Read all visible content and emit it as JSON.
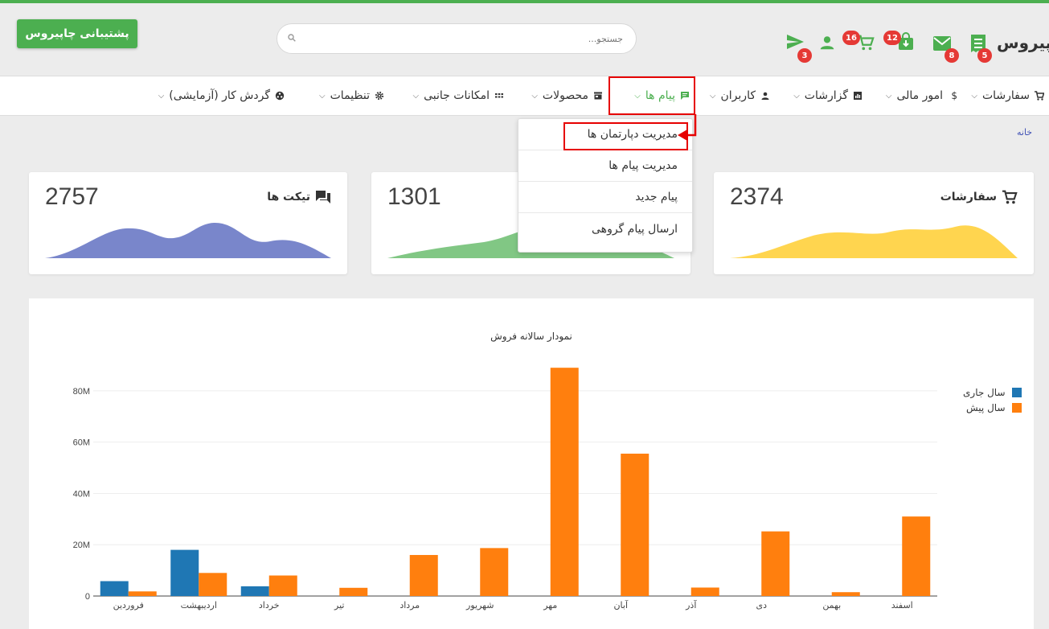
{
  "header": {
    "support_button": "پشتیبانی چاپیروس",
    "search_placeholder": "جستجو...",
    "logo_text": "چاپیروس",
    "badges": {
      "send": "3",
      "orders_cart": "16",
      "downloads": "12",
      "mail": "8",
      "invoices": "5"
    },
    "colors": {
      "brand": "#4caf50",
      "badge": "#e53935"
    }
  },
  "nav": {
    "items": [
      {
        "label": "سفارشات",
        "icon": "cart-icon"
      },
      {
        "label": "امور مالی",
        "icon": "dollar-icon"
      },
      {
        "label": "گزارشات",
        "icon": "report-icon"
      },
      {
        "label": "کاربران",
        "icon": "user-icon"
      },
      {
        "label": "پیام ها",
        "icon": "chat-icon"
      },
      {
        "label": "محصولات",
        "icon": "store-icon"
      },
      {
        "label": "امکانات جانبی",
        "icon": "grid-icon"
      },
      {
        "label": "تنظیمات",
        "icon": "gear-icon"
      },
      {
        "label": "گردش کار (آزمایشی)",
        "icon": "workflow-icon"
      }
    ],
    "active": "پیام ها"
  },
  "dropdown": {
    "items": [
      "مدیریت دپارتمان ها",
      "مدیریت پیام ها",
      "پیام جدید",
      "ارسال پیام گروهی"
    ]
  },
  "breadcrumb": "خانه",
  "cards": [
    {
      "title": "سفارشات",
      "value": "2374",
      "color": "#ffd54f",
      "icon": "cart-icon"
    },
    {
      "title": "",
      "value": "1301",
      "color": "#81c784",
      "icon": ""
    },
    {
      "title": "تیکت ها",
      "value": "2757",
      "color": "#7986cb",
      "icon": "forum-icon"
    }
  ],
  "chart_data": {
    "type": "bar",
    "title": "نمودار سالانه فروش",
    "categories": [
      "فروردین",
      "اردیبهشت",
      "خرداد",
      "تیر",
      "مرداد",
      "شهریور",
      "مهر",
      "آبان",
      "آذر",
      "دی",
      "بهمن",
      "اسفند"
    ],
    "series": [
      {
        "name": "سال جاری",
        "color": "#1f77b4",
        "values": [
          5.8,
          18,
          3.8,
          0,
          0,
          0,
          0,
          0,
          0,
          0,
          0,
          0
        ]
      },
      {
        "name": "سال پیش",
        "color": "#ff7f0e",
        "values": [
          1.8,
          9,
          8,
          3.2,
          16,
          18.7,
          89,
          55.5,
          3.3,
          25.2,
          1.5,
          31
        ]
      }
    ],
    "yticks": [
      "0",
      "20M",
      "40M",
      "60M",
      "80M"
    ],
    "ylim": [
      0,
      90
    ],
    "unit": "M",
    "grid": true,
    "legend": "top-right"
  }
}
